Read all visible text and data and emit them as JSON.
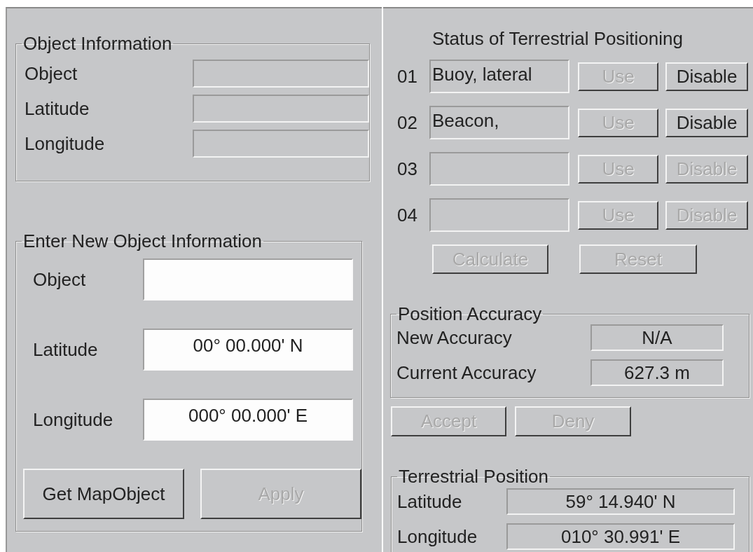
{
  "object_information": {
    "title": "Object Information",
    "fields": [
      {
        "label": "Object"
      },
      {
        "label": "Latitude"
      },
      {
        "label": "Longitude"
      }
    ]
  },
  "new_object_information": {
    "title": "Enter New Object Information",
    "fields": [
      {
        "label": "Object"
      },
      {
        "label": "Latitude",
        "value": "00° 00.000' N"
      },
      {
        "label": "Longitude",
        "value": "000° 00.000' E"
      }
    ],
    "buttons": [
      {
        "label": "Get MapObject",
        "disabled": false
      },
      {
        "label": "Apply",
        "disabled": true
      }
    ]
  },
  "terrestrial_positioning": {
    "title": "Status of Terrestrial Positioning",
    "slots": [
      {
        "number": "01",
        "name": "Buoy, lateral",
        "use": {
          "label": "Use",
          "disabled": true
        },
        "disable": {
          "label": "Disable",
          "disabled": false
        }
      },
      {
        "number": "02",
        "name": "Beacon,",
        "use": {
          "label": "Use",
          "disabled": true
        },
        "disable": {
          "label": "Disable",
          "disabled": false
        }
      },
      {
        "number": "03",
        "use": {
          "label": "Use",
          "disabled": true
        },
        "disable": {
          "label": "Disable",
          "disabled": true
        }
      },
      {
        "number": "04",
        "use": {
          "label": "Use",
          "disabled": true
        },
        "disable": {
          "label": "Disable",
          "disabled": true
        }
      }
    ],
    "buttons": [
      {
        "label": "Calculate",
        "disabled": true
      },
      {
        "label": "Reset",
        "disabled": true
      }
    ]
  },
  "position_accuracy": {
    "title": "Position Accuracy",
    "rows": [
      {
        "label": "New Accuracy",
        "value": "N/A"
      },
      {
        "label": "Current Accuracy",
        "value": "627.3 m"
      }
    ],
    "buttons": [
      {
        "label": "Accept",
        "disabled": true
      },
      {
        "label": "Deny",
        "disabled": true
      }
    ]
  },
  "terrestrial_position": {
    "title": "Terrestrial Position",
    "rows": [
      {
        "label": "Latitude",
        "value": "59° 14.940' N"
      },
      {
        "label": "Longitude",
        "value": "010° 30.991' E"
      }
    ]
  }
}
